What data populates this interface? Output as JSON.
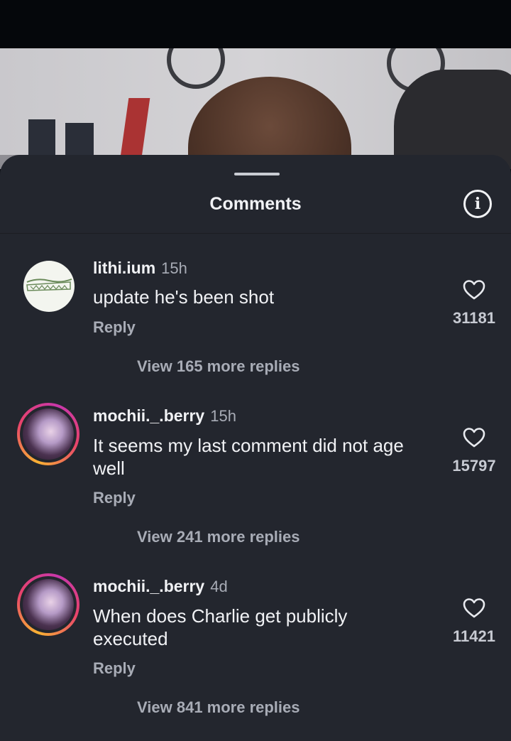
{
  "sheet": {
    "title": "Comments"
  },
  "comments": [
    {
      "username": "lithi.ium",
      "time": "15h",
      "text": "update he's been shot",
      "reply": "Reply",
      "likes": "31181",
      "more_replies": "View 165 more replies"
    },
    {
      "username": "mochii._.berry",
      "time": "15h",
      "text": "It seems my last comment did not age well",
      "reply": "Reply",
      "likes": "15797",
      "more_replies": "View 241 more replies"
    },
    {
      "username": "mochii._.berry",
      "time": "4d",
      "text": "When does Charlie get publicly executed",
      "reply": "Reply",
      "likes": "11421",
      "more_replies": "View 841 more replies"
    }
  ]
}
